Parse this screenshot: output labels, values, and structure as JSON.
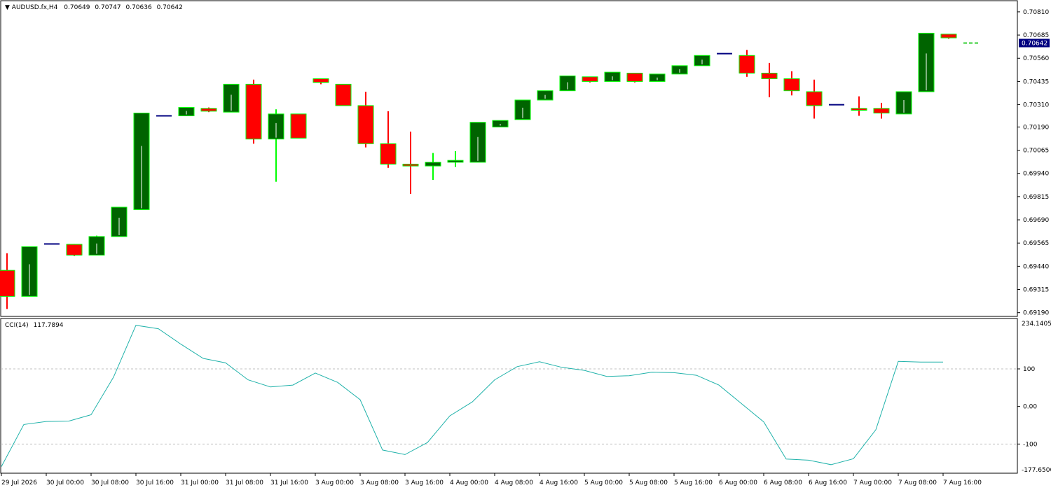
{
  "chart_data": {
    "type": "candlestick",
    "header": {
      "symbol": "AUDUSD.fx,H4",
      "open": "0.70649",
      "high": "0.70747",
      "low": "0.70636",
      "close": "0.70642"
    },
    "price_axis": {
      "ylim": [
        0.6917,
        0.7087
      ],
      "ticks": [
        "0.70810",
        "0.70685",
        "0.70560",
        "0.70435",
        "0.70310",
        "0.70190",
        "0.70065",
        "0.69940",
        "0.69815",
        "0.69690",
        "0.69565",
        "0.69440",
        "0.69315",
        "0.69190"
      ],
      "current_price": "0.70642"
    },
    "time_axis": {
      "labels": [
        "29 Jul 2026",
        "30 Jul 00:00",
        "30 Jul 08:00",
        "30 Jul 16:00",
        "31 Jul 00:00",
        "31 Jul 08:00",
        "31 Jul 16:00",
        "3 Aug 00:00",
        "3 Aug 08:00",
        "3 Aug 16:00",
        "4 Aug 00:00",
        "4 Aug 08:00",
        "4 Aug 16:00",
        "5 Aug 00:00",
        "5 Aug 08:00",
        "5 Aug 16:00",
        "6 Aug 00:00",
        "6 Aug 08:00",
        "6 Aug 16:00",
        "7 Aug 00:00",
        "7 Aug 08:00",
        "7 Aug 16:00"
      ],
      "label_every_bars": 2
    },
    "candles": [
      {
        "o": 0.69418,
        "h": 0.6951,
        "l": 0.6921,
        "c": 0.69278
      },
      {
        "o": 0.69278,
        "h": 0.69545,
        "l": 0.69278,
        "c": 0.69545
      },
      {
        "o": 0.6956,
        "h": 0.6956,
        "l": 0.6956,
        "c": 0.6956
      },
      {
        "o": 0.69558,
        "h": 0.6956,
        "l": 0.69495,
        "c": 0.695
      },
      {
        "o": 0.695,
        "h": 0.69605,
        "l": 0.695,
        "c": 0.696
      },
      {
        "o": 0.696,
        "h": 0.69758,
        "l": 0.696,
        "c": 0.69758
      },
      {
        "o": 0.69745,
        "h": 0.70265,
        "l": 0.69745,
        "c": 0.70265
      },
      {
        "o": 0.7025,
        "h": 0.70265,
        "l": 0.70245,
        "c": 0.7025
      },
      {
        "o": 0.7025,
        "h": 0.70295,
        "l": 0.7025,
        "c": 0.70295
      },
      {
        "o": 0.7029,
        "h": 0.70295,
        "l": 0.7027,
        "c": 0.70275
      },
      {
        "o": 0.7027,
        "h": 0.7042,
        "l": 0.7027,
        "c": 0.7042
      },
      {
        "o": 0.7042,
        "h": 0.70445,
        "l": 0.701,
        "c": 0.70125
      },
      {
        "o": 0.70125,
        "h": 0.70285,
        "l": 0.69895,
        "c": 0.7026
      },
      {
        "o": 0.7026,
        "h": 0.7026,
        "l": 0.7013,
        "c": 0.7013
      },
      {
        "o": 0.7045,
        "h": 0.7045,
        "l": 0.7042,
        "c": 0.7043
      },
      {
        "o": 0.7042,
        "h": 0.7042,
        "l": 0.70305,
        "c": 0.70305
      },
      {
        "o": 0.70305,
        "h": 0.7038,
        "l": 0.7008,
        "c": 0.701
      },
      {
        "o": 0.701,
        "h": 0.70275,
        "l": 0.6997,
        "c": 0.6999
      },
      {
        "o": 0.6999,
        "h": 0.70165,
        "l": 0.6983,
        "c": 0.6998
      },
      {
        "o": 0.6998,
        "h": 0.7005,
        "l": 0.69905,
        "c": 0.7
      },
      {
        "o": 0.7,
        "h": 0.7006,
        "l": 0.69975,
        "c": 0.7001
      },
      {
        "o": 0.7,
        "h": 0.70215,
        "l": 0.7,
        "c": 0.70215
      },
      {
        "o": 0.7019,
        "h": 0.70225,
        "l": 0.7019,
        "c": 0.70225
      },
      {
        "o": 0.7023,
        "h": 0.70335,
        "l": 0.7023,
        "c": 0.70335
      },
      {
        "o": 0.70335,
        "h": 0.70385,
        "l": 0.70335,
        "c": 0.70385
      },
      {
        "o": 0.70385,
        "h": 0.70465,
        "l": 0.70385,
        "c": 0.70465
      },
      {
        "o": 0.7046,
        "h": 0.7046,
        "l": 0.7043,
        "c": 0.70435
      },
      {
        "o": 0.70435,
        "h": 0.70485,
        "l": 0.70435,
        "c": 0.70485
      },
      {
        "o": 0.7048,
        "h": 0.7048,
        "l": 0.7043,
        "c": 0.70435
      },
      {
        "o": 0.70435,
        "h": 0.70475,
        "l": 0.70435,
        "c": 0.70475
      },
      {
        "o": 0.70475,
        "h": 0.7052,
        "l": 0.70475,
        "c": 0.7052
      },
      {
        "o": 0.7052,
        "h": 0.70575,
        "l": 0.7052,
        "c": 0.70575
      },
      {
        "o": 0.70585,
        "h": 0.70585,
        "l": 0.70585,
        "c": 0.70585
      },
      {
        "o": 0.70575,
        "h": 0.70605,
        "l": 0.7046,
        "c": 0.7048
      },
      {
        "o": 0.7048,
        "h": 0.70535,
        "l": 0.7035,
        "c": 0.7045
      },
      {
        "o": 0.7045,
        "h": 0.7049,
        "l": 0.7036,
        "c": 0.70385
      },
      {
        "o": 0.7038,
        "h": 0.70445,
        "l": 0.70235,
        "c": 0.70305
      },
      {
        "o": 0.7031,
        "h": 0.7039,
        "l": 0.7028,
        "c": 0.7031
      },
      {
        "o": 0.7029,
        "h": 0.70355,
        "l": 0.7025,
        "c": 0.7028
      },
      {
        "o": 0.7029,
        "h": 0.7032,
        "l": 0.70235,
        "c": 0.70265
      },
      {
        "o": 0.7026,
        "h": 0.7038,
        "l": 0.7026,
        "c": 0.7038
      },
      {
        "o": 0.7038,
        "h": 0.70695,
        "l": 0.7038,
        "c": 0.70695
      },
      {
        "o": 0.7069,
        "h": 0.7069,
        "l": 0.70665,
        "c": 0.7067
      },
      {
        "o": 0.70649,
        "h": 0.7065,
        "l": 0.70636,
        "c": 0.70642
      }
    ],
    "colors": {
      "bull_body": "#006400",
      "bear_body": "#ff0000",
      "candle_outline": "#00ff00",
      "bear_wick": "#ff0000",
      "doji": "#000080",
      "current_candle": "#32cd32",
      "price_tag_bg": "#000080",
      "cci_line": "#20b2aa",
      "level_line": "#c0c0c0",
      "frame": "#000000"
    },
    "indicator": {
      "name": "CCI(14)",
      "value": "117.7894",
      "ylim": [
        -177.6506,
        234.1405
      ],
      "top_label": "234.1405",
      "bottom_label": "-177.6506",
      "ticks": [
        "100",
        "0.00",
        "-100"
      ],
      "levels": [
        100,
        -100
      ],
      "values": [
        -160,
        -48,
        -40,
        -39,
        -22,
        78,
        216,
        207,
        166,
        128,
        116,
        71,
        52,
        57,
        89,
        64,
        18,
        -116,
        -128,
        -96,
        -25,
        12,
        71,
        106,
        119,
        104,
        96,
        80,
        82,
        91,
        90,
        83,
        57,
        8,
        -41,
        -140,
        -143,
        -155,
        -139,
        -62,
        120,
        118,
        118
      ]
    }
  }
}
